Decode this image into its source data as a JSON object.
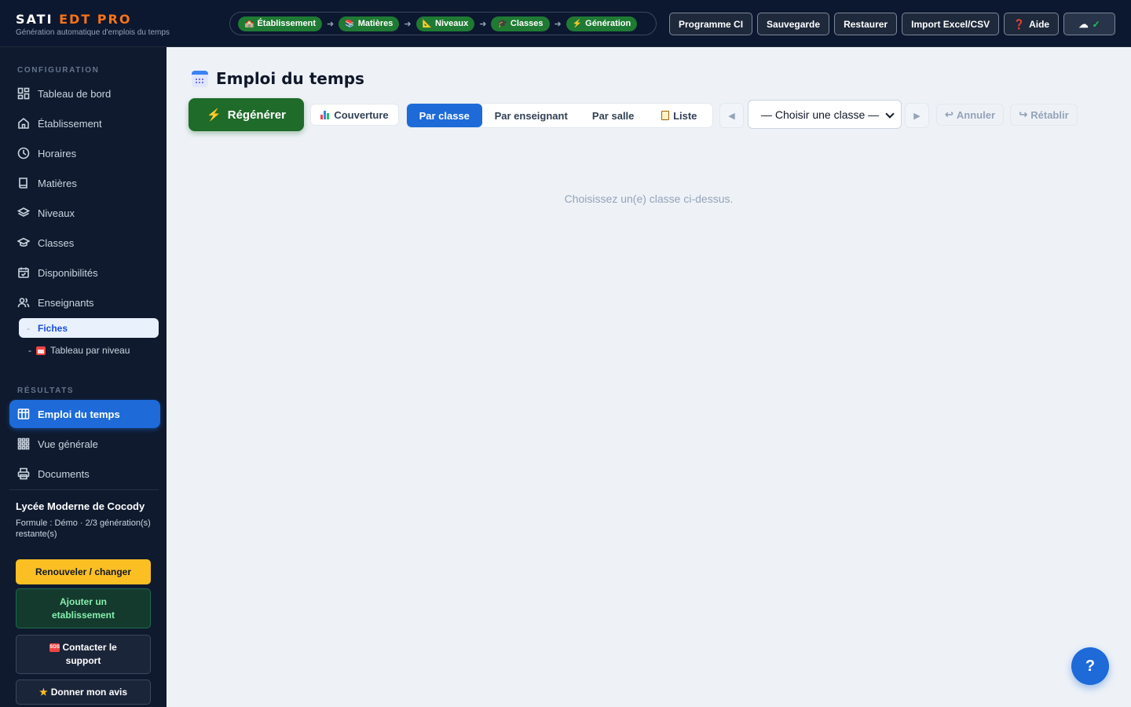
{
  "brand": {
    "title_main": "SATI ",
    "title_accent": "EDT PRO",
    "subtitle": "Génération automatique d'emplois du temps"
  },
  "steps": [
    "Établissement",
    "Matières",
    "Niveaux",
    "Classes",
    "Génération"
  ],
  "top_actions": {
    "programme": "Programme CI",
    "sauvegarde": "Sauvegarde",
    "restaurer": "Restaurer",
    "import": "Import Excel/CSV",
    "aide": "Aide"
  },
  "sidebar": {
    "config_label": "CONFIGURATION",
    "items": [
      "Tableau de bord",
      "Établissement",
      "Horaires",
      "Matières",
      "Niveaux",
      "Classes",
      "Disponibilités",
      "Enseignants"
    ],
    "teacher_sub": {
      "fiches": "Fiches",
      "tableau": "Tableau par niveau"
    },
    "results_label": "RÉSULTATS",
    "results": [
      "Emploi du temps",
      "Vue générale",
      "Documents"
    ],
    "school_name": "Lycée Moderne de Cocody",
    "school_plan": "Formule : Démo · 2/3 génération(s) restante(s)",
    "btn_renew": "Renouveler / changer",
    "btn_add": "Ajouter un etablissement",
    "btn_support": "Contacter le support",
    "btn_review": "Donner mon avis"
  },
  "main": {
    "title": "Emploi du temps",
    "regen": "Régénérer",
    "couverture": "Couverture",
    "tabs": [
      "Par classe",
      "Par enseignant",
      "Par salle",
      "Liste"
    ],
    "select_value": "— Choisir une classe —",
    "annuler": "Annuler",
    "retablir": "Rétablir",
    "empty": "Choisissez un(e) classe ci-dessus."
  },
  "help_fab": "?"
}
